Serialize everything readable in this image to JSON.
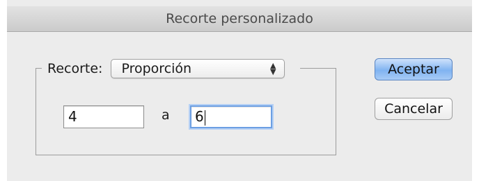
{
  "window": {
    "title": "Recorte personalizado"
  },
  "crop": {
    "label": "Recorte:",
    "mode_value": "Proporción",
    "width_value": "4",
    "separator": "a",
    "height_value": "6"
  },
  "buttons": {
    "ok": "Aceptar",
    "cancel": "Cancelar"
  },
  "icons": {
    "popup_arrows": "up-down-chevron-icon"
  },
  "colors": {
    "focus_ring": "#6c9fe3",
    "default_button": "#80b3f1"
  }
}
